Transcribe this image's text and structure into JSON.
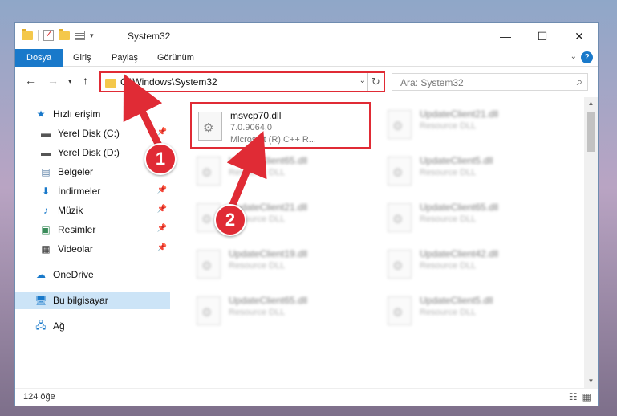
{
  "window": {
    "title": "System32",
    "controls": {
      "minimize": "—",
      "maximize": "☐",
      "close": "✕"
    }
  },
  "ribbon": {
    "tabs": [
      {
        "label": "Dosya"
      },
      {
        "label": "Giriş"
      },
      {
        "label": "Paylaş"
      },
      {
        "label": "Görünüm"
      }
    ],
    "help_label": "?"
  },
  "address": {
    "path": "C:\\Windows\\System32",
    "search_placeholder": "Ara: System32"
  },
  "sidebar": {
    "items": [
      {
        "label": "Hızlı erişim",
        "icon": "star-icon",
        "pinned": false
      },
      {
        "label": "Yerel Disk (C:)",
        "icon": "drive-icon",
        "pinned": true
      },
      {
        "label": "Yerel Disk (D:)",
        "icon": "drive-icon",
        "pinned": false
      },
      {
        "label": "Belgeler",
        "icon": "documents-icon",
        "pinned": true
      },
      {
        "label": "İndirmeler",
        "icon": "download-icon",
        "pinned": true
      },
      {
        "label": "Müzik",
        "icon": "music-icon",
        "pinned": true
      },
      {
        "label": "Resimler",
        "icon": "pictures-icon",
        "pinned": true
      },
      {
        "label": "Videolar",
        "icon": "video-icon",
        "pinned": true
      },
      {
        "label": "OneDrive",
        "icon": "cloud-icon",
        "pinned": false
      },
      {
        "label": "Bu bilgisayar",
        "icon": "computer-icon",
        "pinned": false,
        "selected": true
      },
      {
        "label": "Ağ",
        "icon": "network-icon",
        "pinned": false
      }
    ]
  },
  "files": [
    {
      "name": "msvcp70.dll",
      "version": "7.0.9064.0",
      "description": "Microsoft (R) C++ R...",
      "highlighted": true
    },
    {
      "name": "UpdateClient21.dll",
      "description": "Resource DLL"
    },
    {
      "name": "UpdateClient65.dll",
      "description": "Resource DLL"
    },
    {
      "name": "UpdateClient5.dll",
      "description": "Resource DLL"
    },
    {
      "name": "UpdateClient21.dll",
      "description": "Resource DLL"
    },
    {
      "name": "UpdateClient65.dll",
      "description": "Resource DLL"
    },
    {
      "name": "UpdateClient19.dll",
      "description": "Resource DLL"
    },
    {
      "name": "UpdateClient42.dll",
      "description": "Resource DLL"
    },
    {
      "name": "UpdateClient65.dll",
      "description": "Resource DLL"
    },
    {
      "name": "UpdateClient5.dll",
      "description": "Resource DLL"
    }
  ],
  "status": {
    "count": "124 öğe"
  },
  "annotations": {
    "step1": "1",
    "step2": "2",
    "color": "#e02b35"
  }
}
